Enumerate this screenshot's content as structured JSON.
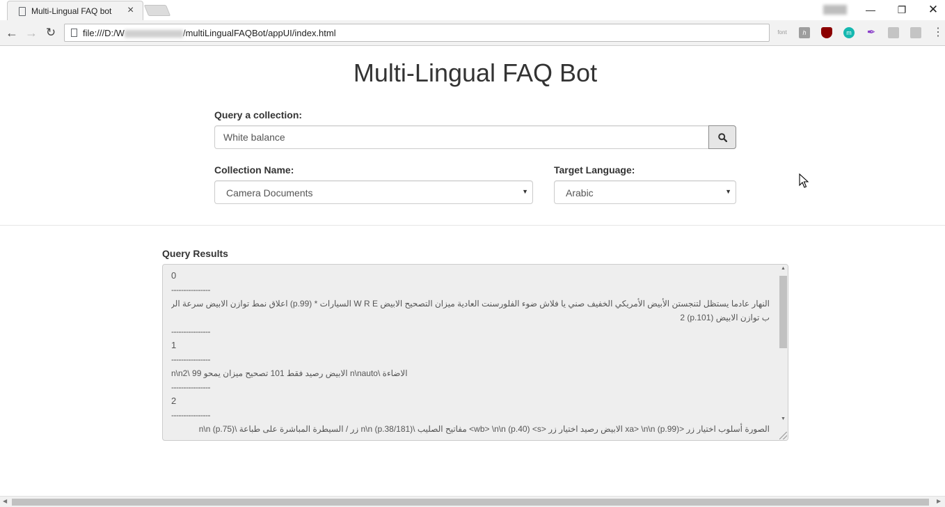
{
  "browser": {
    "tab_title": "Multi-Lingual FAQ bot",
    "tab_close": "×",
    "url_prefix": "file:///D:/W",
    "url_suffix": "/multiLingualFAQBot/appUI/index.html",
    "ext_font_label": "font",
    "ext_h_label": "h",
    "ext_m_label": "m",
    "win_min": "—",
    "win_max": "❐",
    "win_close": "✕",
    "menu": "⋮"
  },
  "page": {
    "title": "Multi-Lingual FAQ Bot"
  },
  "query": {
    "label": "Query a collection:",
    "value": "White balance"
  },
  "collection": {
    "label": "Collection Name:",
    "selected": "Camera Documents"
  },
  "language": {
    "label": "Target Language:",
    "selected": "Arabic"
  },
  "results": {
    "label": "Query Results",
    "lines": [
      "0",
      " ----------------",
      "النهار عادما يستظل لتنجستن الأبيض الأمريكي الخفيف صني يا فلاش ضوء الفلورسنت العادية ميزان التصحيح الابيض W R E السيارات * (p.99) اعلاق نمط توازن الابيض سرعة الرماية (",
      "ب توازن الابيض (p.101) 2",
      " ----------------",
      "1",
      " ----------------",
      "الاضاءة \\n\\nauto الابيض رصيد فقط 101 تصحيح ميزان يمحو 99 \\n\\n2",
      " ----------------",
      "2",
      " ----------------",
      "الصورة أسلوب اختيار زر <xa> \\n\\n (p.99) الابيض رصيد اختيار زر <wb> \\n\\n (p.40) <s> مفاتيح الصليب \\n\\n (p.38/181) زر / السيطرة المباشرة على طباعة \\n\\n (p.75)",
      "..."
    ]
  }
}
